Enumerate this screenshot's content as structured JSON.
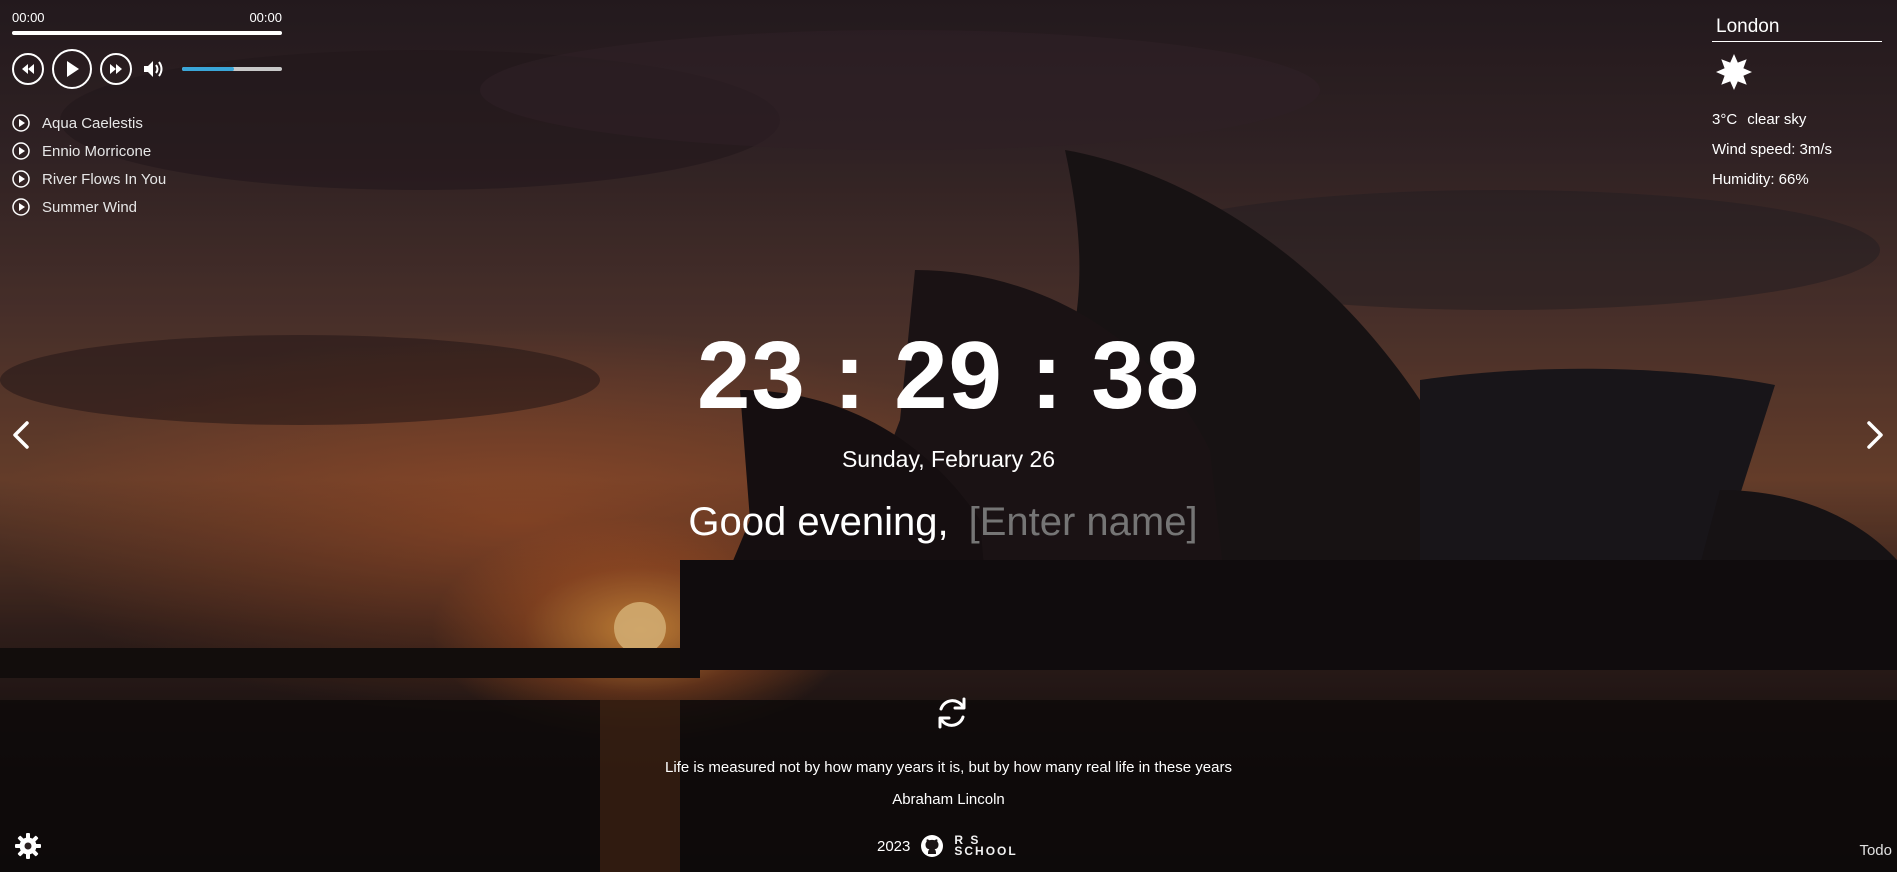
{
  "player": {
    "current_time": "00:00",
    "duration": "00:00",
    "progress_fraction": 1.0,
    "volume_fraction": 0.52,
    "volume_color": "#3aa6d8",
    "icons": [
      "rewind-icon",
      "play-icon",
      "forward-icon",
      "volume-icon"
    ],
    "playlist": [
      {
        "title": "Aqua Caelestis"
      },
      {
        "title": "Ennio Morricone"
      },
      {
        "title": "River Flows In You"
      },
      {
        "title": "Summer Wind"
      }
    ]
  },
  "weather": {
    "city": "London",
    "icon": "sun-icon",
    "temperature": "3°C",
    "description": "clear sky",
    "wind": "Wind speed: 3m/s",
    "humidity": "Humidity: 66%"
  },
  "clock": {
    "time": "23 : 29 : 38",
    "date": "Sunday, February 26"
  },
  "greeting": {
    "text": "Good evening,",
    "name_placeholder": "[Enter name]"
  },
  "slider": {
    "prev_icon": "chevron-left-icon",
    "next_icon": "chevron-right-icon"
  },
  "quote": {
    "refresh_icon": "refresh-icon",
    "text": "Life is measured not by how many years it is, but by how many real life in these years",
    "author": "Abraham Lincoln"
  },
  "footer": {
    "year": "2023",
    "github_icon": "github-icon",
    "school_logo_text": "RS SCHOOL",
    "settings_icon": "gear-icon",
    "todo_label": "Todo"
  }
}
